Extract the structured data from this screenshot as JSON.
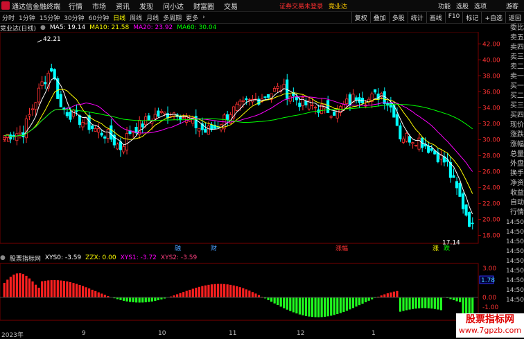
{
  "titlebar": {
    "app": "通达信金融终端",
    "menus": [
      "行情",
      "市场",
      "资讯",
      "发现",
      "问小达",
      "财富圈",
      "交易"
    ],
    "alert": "证券交易未登录",
    "stock_tag": "竟业达",
    "right_items": [
      "功能",
      "选股",
      "选项",
      "游客"
    ]
  },
  "periods": [
    "分时",
    "1分钟",
    "15分钟",
    "30分钟",
    "60分钟",
    "日线",
    "周线",
    "月线",
    "多周期",
    "更多"
  ],
  "active_period": "日线",
  "tools": [
    "复权",
    "叠加",
    "多股",
    "统计",
    "画线",
    "F10",
    "标记",
    "+自选",
    "返回"
  ],
  "main_info": {
    "stock": "竞业达(日线)",
    "ma5": "MA5: 19.14",
    "ma10": "MA10: 21.58",
    "ma20": "MA20: 23.92",
    "ma60": "MA60: 30.04"
  },
  "sub_info": {
    "name": "股票指标网",
    "xys0": "XYS0: -3.59",
    "zzx": "ZZX: 0.00",
    "xys1": "XYS1: -3.72",
    "xys2": "XYS2: -3.59"
  },
  "sidebar": [
    "委比",
    "卖五",
    "卖四",
    "卖三",
    "卖二",
    "卖一",
    "买一",
    "买二",
    "买三",
    "买四",
    "现价",
    "涨跌",
    "涨幅",
    "总量",
    "外盘",
    "换手",
    "净资",
    "收益",
    "自动",
    "行情"
  ],
  "sidebar_times": [
    "14:50",
    "14:50",
    "14:50",
    "14:50",
    "14:50",
    "14:50",
    "14:50",
    "14:50",
    "14:50"
  ],
  "chart_data": {
    "type": "candlestick",
    "y_ticks": [
      "42.00",
      "40.00",
      "38.00",
      "36.00",
      "34.00",
      "32.00",
      "30.00",
      "28.00",
      "26.00",
      "24.00",
      "22.00",
      "20.00",
      "18.00"
    ],
    "ylim": [
      17,
      43.5
    ],
    "high_label": "42.21",
    "low_label": "17.14",
    "price_start_label": "30",
    "event_labels": [
      "融",
      "财",
      "涨幅",
      "跌"
    ],
    "event_label_special": "跌",
    "sub_y_ticks": [
      "3.00",
      "0.00",
      "-1.00"
    ],
    "sub_current": "1.78",
    "x_labels": [
      "2023年",
      "9",
      "10",
      "11",
      "12",
      "1"
    ]
  },
  "watermark": {
    "title": "股票指标网",
    "url": "www.7gpzb.com"
  },
  "colors": {
    "up": "#ff3232",
    "down": "#00ffff",
    "ma5": "#ffffff",
    "ma10": "#ffff00",
    "ma20": "#ff00ff",
    "ma60": "#00ff00"
  }
}
